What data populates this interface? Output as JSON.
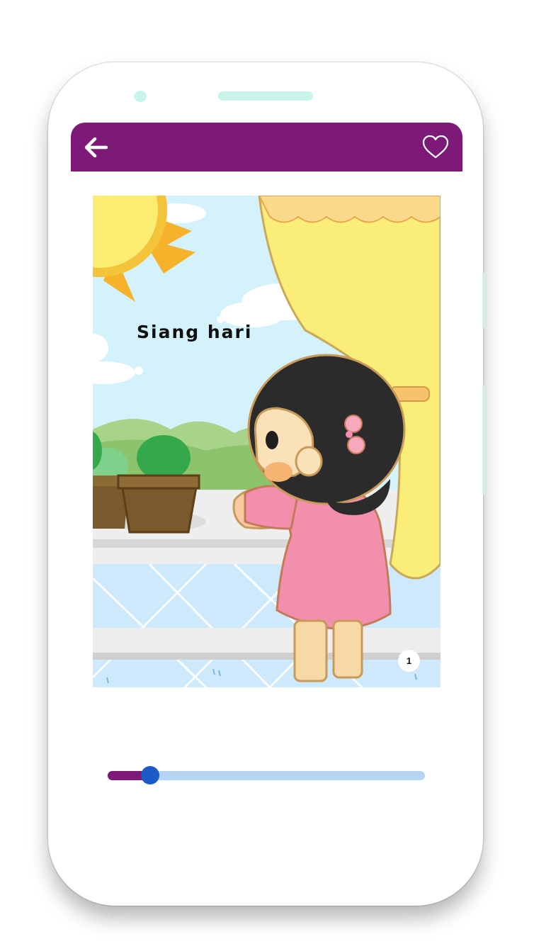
{
  "toolbar": {
    "back_icon": "arrow-left-icon",
    "favorite_icon": "heart-outline-icon",
    "color": "#7d1a78"
  },
  "page": {
    "title_text": "Siang hari",
    "page_number": "1",
    "illustration": "girl-at-window-illustration"
  },
  "slider": {
    "value_fraction": 0.104,
    "fill_color": "#7d1a78",
    "track_color": "#b6d4f3",
    "thumb_color": "#1a5bc7"
  }
}
